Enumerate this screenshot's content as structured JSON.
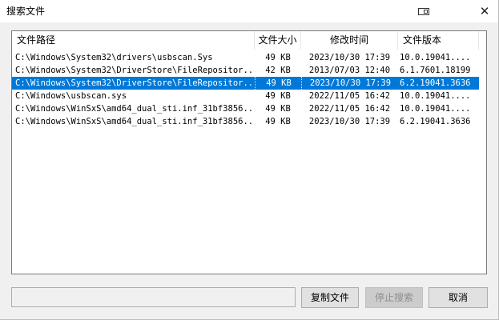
{
  "window": {
    "title": "搜索文件"
  },
  "table": {
    "columns": [
      "文件路径",
      "文件大小",
      "修改时间",
      "文件版本"
    ],
    "rows": [
      {
        "path": "C:\\Windows\\System32\\drivers\\usbscan.Sys",
        "size": "49 KB",
        "modified": "2023/10/30 17:39",
        "version": "10.0.19041...."
      },
      {
        "path": "C:\\Windows\\System32\\DriverStore\\FileRepositor...",
        "size": "42 KB",
        "modified": "2013/07/03 12:40",
        "version": "6.1.7601.18199"
      },
      {
        "path": "C:\\Windows\\System32\\DriverStore\\FileRepositor...",
        "size": "49 KB",
        "modified": "2023/10/30 17:39",
        "version": "6.2.19041.3636",
        "selected": true
      },
      {
        "path": "C:\\Windows\\usbscan.sys",
        "size": "49 KB",
        "modified": "2022/11/05 16:42",
        "version": "10.0.19041...."
      },
      {
        "path": "C:\\Windows\\WinSxS\\amd64_dual_sti.inf_31bf3856...",
        "size": "49 KB",
        "modified": "2022/11/05 16:42",
        "version": "10.0.19041...."
      },
      {
        "path": "C:\\Windows\\WinSxS\\amd64_dual_sti.inf_31bf3856...",
        "size": "49 KB",
        "modified": "2023/10/30 17:39",
        "version": "6.2.19041.3636"
      }
    ]
  },
  "footer": {
    "status_text": "",
    "copy_button": "复制文件",
    "stop_button": "停止搜索",
    "cancel_button": "取消"
  },
  "icons": {
    "restore": "restore-icon",
    "close": "close-icon"
  },
  "colors": {
    "selection": "#0078d7",
    "dialog_bg": "#f0f0f0"
  }
}
